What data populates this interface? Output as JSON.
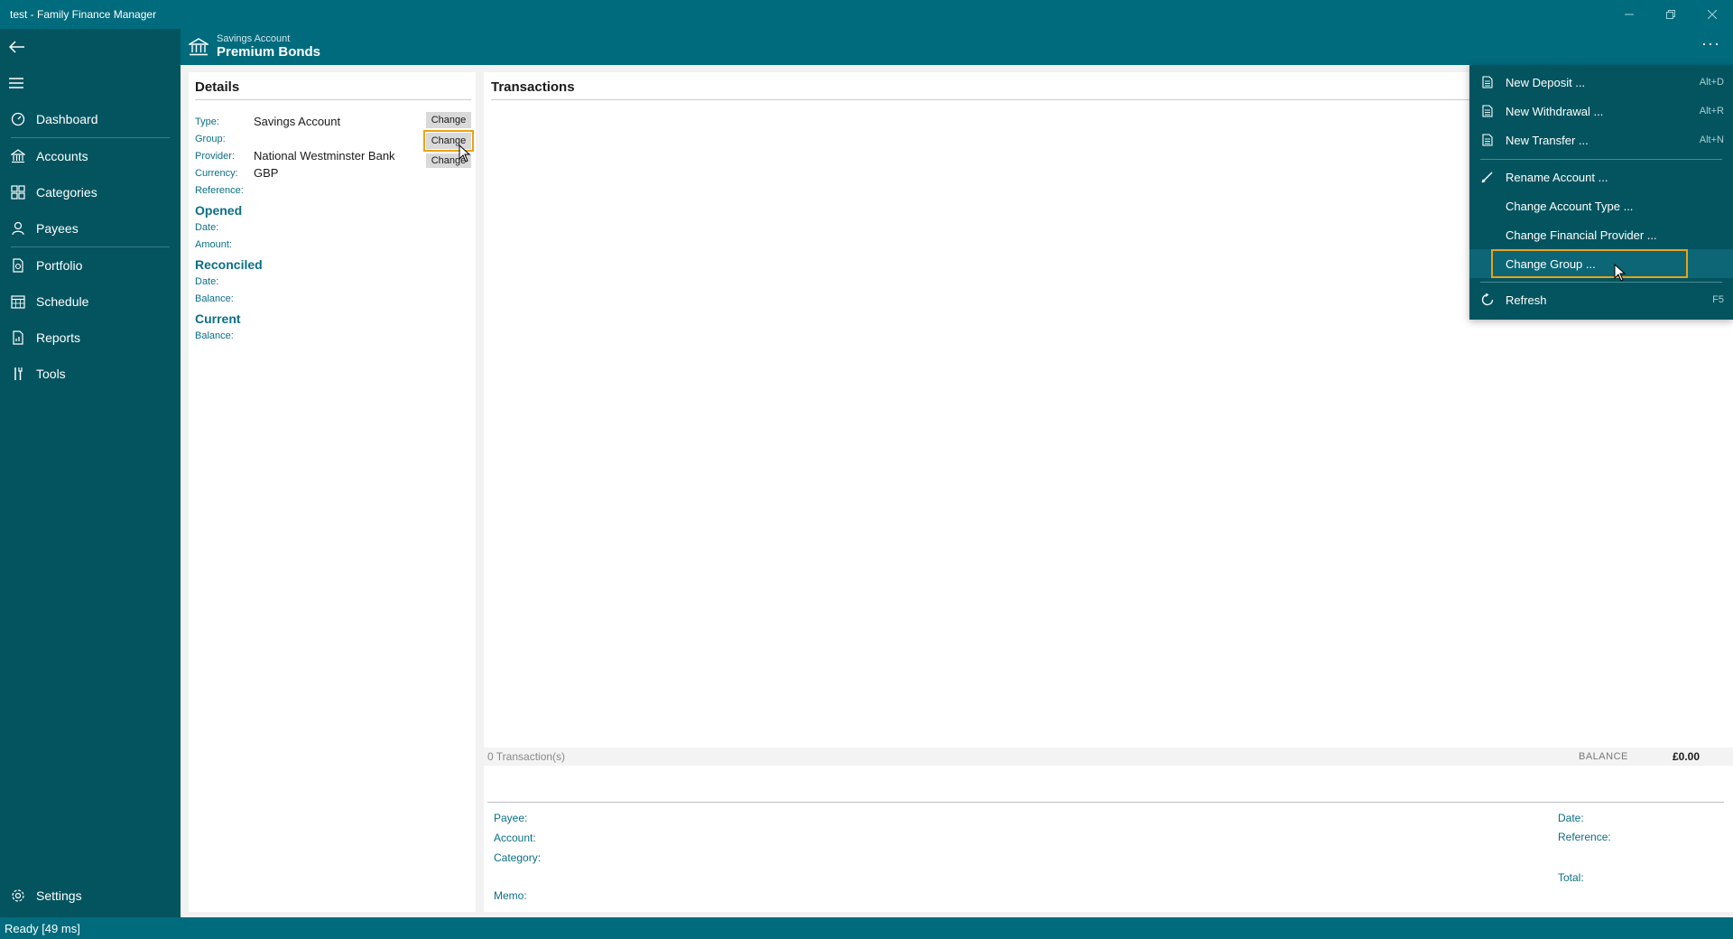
{
  "window": {
    "title": "test - Family Finance Manager",
    "controls": [
      "minimize",
      "restore",
      "close"
    ]
  },
  "sidebar": {
    "items": [
      {
        "label": "Dashboard",
        "icon": "dashboard-icon"
      },
      {
        "label": "Accounts",
        "icon": "bank-icon"
      },
      {
        "label": "Categories",
        "icon": "categories-icon"
      },
      {
        "label": "Payees",
        "icon": "person-icon"
      },
      {
        "label": "Portfolio",
        "icon": "portfolio-icon"
      },
      {
        "label": "Schedule",
        "icon": "calendar-icon"
      },
      {
        "label": "Reports",
        "icon": "report-icon"
      },
      {
        "label": "Tools",
        "icon": "tools-icon"
      }
    ],
    "settings_label": "Settings"
  },
  "header": {
    "subtitle": "Savings Account",
    "title": "Premium Bonds",
    "more": "···"
  },
  "details": {
    "title": "Details",
    "type_label": "Type:",
    "type_value": "Savings Account",
    "group_label": "Group:",
    "provider_label": "Provider:",
    "provider_value": "National Westminster Bank",
    "currency_label": "Currency:",
    "currency_value": "GBP",
    "reference_label": "Reference:",
    "change_label": "Change",
    "opened_title": "Opened",
    "opened_date_label": "Date:",
    "opened_amount_label": "Amount:",
    "reconciled_title": "Reconciled",
    "reconciled_date_label": "Date:",
    "reconciled_balance_label": "Balance:",
    "current_title": "Current",
    "current_balance_label": "Balance:"
  },
  "transactions": {
    "title": "Transactions",
    "count_text": "0 Transaction(s)",
    "balance_label": "BALANCE",
    "balance_value": "£0.00",
    "payee_label": "Payee:",
    "account_label": "Account:",
    "category_label": "Category:",
    "memo_label": "Memo:",
    "date_label": "Date:",
    "reference_label": "Reference:",
    "total_label": "Total:"
  },
  "menu": {
    "new_deposit": "New Deposit ...",
    "new_deposit_shortcut": "Alt+D",
    "new_withdrawal": "New Withdrawal ...",
    "new_withdrawal_shortcut": "Alt+R",
    "new_transfer": "New Transfer ...",
    "new_transfer_shortcut": "Alt+N",
    "rename_account": "Rename Account ...",
    "change_account_type": "Change Account Type ...",
    "change_financial_provider": "Change Financial Provider ...",
    "change_group": "Change Group ...",
    "refresh": "Refresh",
    "refresh_shortcut": "F5"
  },
  "status": {
    "text": "Ready [49 ms]"
  },
  "colors": {
    "titlebar": "#006b7d",
    "sidebar": "#04545f",
    "accent_text": "#0a6f86",
    "highlight": "#e8a317"
  }
}
